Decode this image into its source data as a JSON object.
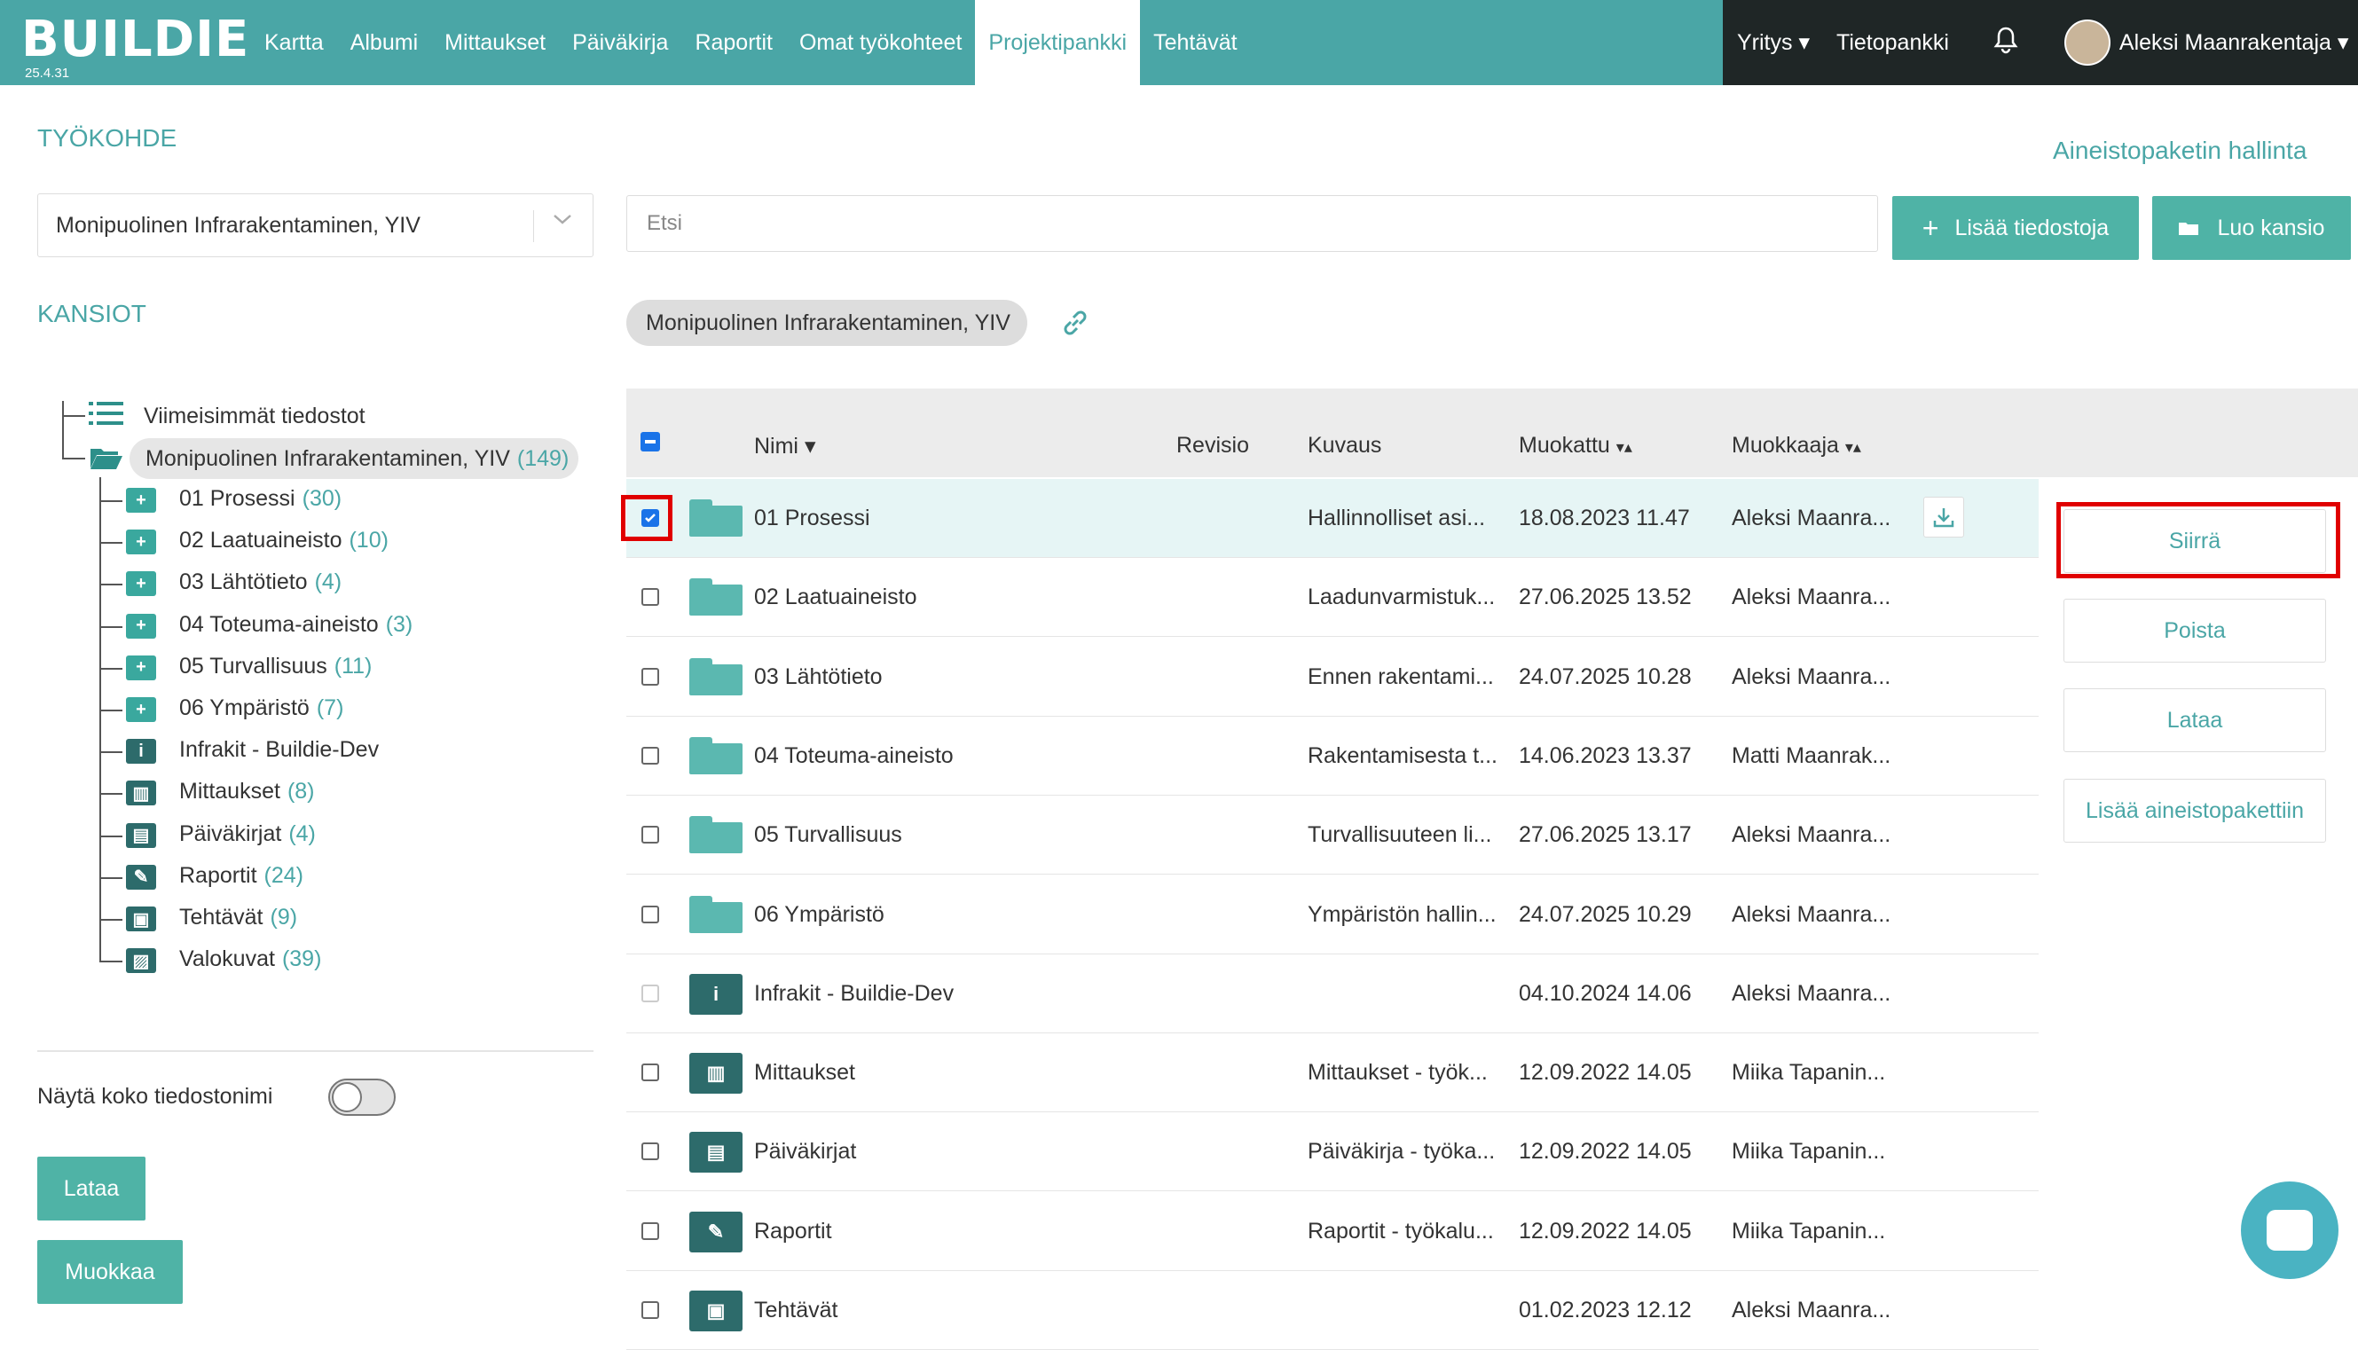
{
  "app": {
    "logo": "BUILDIE",
    "version": "25.4.31"
  },
  "nav": {
    "items": [
      {
        "label": "Kartta"
      },
      {
        "label": "Albumi"
      },
      {
        "label": "Mittaukset"
      },
      {
        "label": "Päiväkirja"
      },
      {
        "label": "Raportit"
      },
      {
        "label": "Omat työkohteet"
      },
      {
        "label": "Projektipankki",
        "active": true
      },
      {
        "label": "Tehtävät"
      }
    ],
    "company": "Yritys ▾",
    "knowledge": "Tietopankki",
    "user": "Aleksi Maanrakentaja ▾"
  },
  "left": {
    "section_title": "TYÖKOHDE",
    "project_select": "Monipuolinen Infrarakentaminen, YIV",
    "folders_title": "KANSIOT",
    "recent": "Viimeisimmät tiedostot",
    "root": {
      "label": "Monipuolinen Infrarakentaminen, YIV",
      "count": "(149)"
    },
    "children": [
      {
        "label": "01 Prosessi",
        "count": "(30)",
        "icon": "folder-plus-icon"
      },
      {
        "label": "02 Laatuaineisto",
        "count": "(10)",
        "icon": "folder-plus-icon"
      },
      {
        "label": "03 Lähtötieto",
        "count": "(4)",
        "icon": "folder-plus-icon"
      },
      {
        "label": "04 Toteuma-aineisto",
        "count": "(3)",
        "icon": "folder-plus-icon"
      },
      {
        "label": "05 Turvallisuus",
        "count": "(11)",
        "icon": "folder-plus-icon"
      },
      {
        "label": "06 Ympäristö",
        "count": "(7)",
        "icon": "folder-plus-icon"
      },
      {
        "label": "Infrakit - Buildie-Dev",
        "count": "",
        "icon": "info-icon"
      },
      {
        "label": "Mittaukset",
        "count": "(8)",
        "icon": "chart-icon"
      },
      {
        "label": "Päiväkirjat",
        "count": "(4)",
        "icon": "diary-icon"
      },
      {
        "label": "Raportit",
        "count": "(24)",
        "icon": "report-icon"
      },
      {
        "label": "Tehtävät",
        "count": "(9)",
        "icon": "task-icon"
      },
      {
        "label": "Valokuvat",
        "count": "(39)",
        "icon": "photo-icon"
      }
    ],
    "show_full_name": "Näytä koko tiedostonimi",
    "download_btn": "Lataa",
    "edit_btn": "Muokkaa"
  },
  "main": {
    "package_link": "Aineistopaketin hallinta",
    "search_placeholder": "Etsi",
    "add_files": "Lisää tiedostoja",
    "create_folder": "Luo kansio",
    "breadcrumb": "Monipuolinen Infrarakentaminen, YIV",
    "columns": {
      "name": "Nimi",
      "revision": "Revisio",
      "description": "Kuvaus",
      "modified": "Muokattu",
      "modifier": "Muokkaaja"
    },
    "rows": [
      {
        "name": "01 Prosessi",
        "description": "Hallinnolliset asi...",
        "modified": "18.08.2023 11.47",
        "modifier": "Aleksi Maanra...",
        "type": "folder",
        "checked": true
      },
      {
        "name": "02 Laatuaineisto",
        "description": "Laadunvarmistuk...",
        "modified": "27.06.2025 13.52",
        "modifier": "Aleksi Maanra...",
        "type": "folder"
      },
      {
        "name": "03 Lähtötieto",
        "description": "Ennen rakentami...",
        "modified": "24.07.2025 10.28",
        "modifier": "Aleksi Maanra...",
        "type": "folder"
      },
      {
        "name": "04 Toteuma-aineisto",
        "description": "Rakentamisesta t...",
        "modified": "14.06.2023 13.37",
        "modifier": "Matti Maanrak...",
        "type": "folder"
      },
      {
        "name": "05 Turvallisuus",
        "description": "Turvallisuuteen li...",
        "modified": "27.06.2025 13.17",
        "modifier": "Aleksi Maanra...",
        "type": "folder"
      },
      {
        "name": "06 Ympäristö",
        "description": "Ympäristön hallin...",
        "modified": "24.07.2025 10.29",
        "modifier": "Aleksi Maanra...",
        "type": "folder"
      },
      {
        "name": "Infrakit - Buildie-Dev",
        "description": "",
        "modified": "04.10.2024 14.06",
        "modifier": "Aleksi Maanra...",
        "type": "info"
      },
      {
        "name": "Mittaukset",
        "description": "Mittaukset - työk...",
        "modified": "12.09.2022 14.05",
        "modifier": "Miika Tapanin...",
        "type": "chart"
      },
      {
        "name": "Päiväkirjat",
        "description": "Päiväkirja - työka...",
        "modified": "12.09.2022 14.05",
        "modifier": "Miika Tapanin...",
        "type": "diary"
      },
      {
        "name": "Raportit",
        "description": "Raportit - työkalu...",
        "modified": "12.09.2022 14.05",
        "modifier": "Miika Tapanin...",
        "type": "report"
      },
      {
        "name": "Tehtävät",
        "description": "",
        "modified": "01.02.2023 12.12",
        "modifier": "Aleksi Maanra...",
        "type": "task"
      }
    ]
  },
  "actions": {
    "move": "Siirrä",
    "delete": "Poista",
    "download": "Lataa",
    "add_to_package": "Lisää aineistopakettiin"
  },
  "colors": {
    "accent": "#4aa6a6",
    "button": "#4fb3a6",
    "highlight": "#e00000"
  }
}
